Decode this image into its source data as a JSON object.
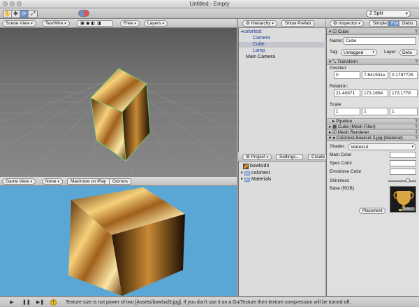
{
  "window": {
    "title": "Untitled - Empty"
  },
  "toolbar": {
    "tools": [
      {
        "name": "hand-icon",
        "glyph": "✋"
      },
      {
        "name": "move-icon",
        "glyph": "✥"
      },
      {
        "name": "rotate-icon",
        "glyph": "⟳"
      },
      {
        "name": "scale-icon",
        "glyph": "⤢"
      }
    ],
    "layout_select": "2 Split"
  },
  "scene_view": {
    "tab_label": "Scene View",
    "render_mode": "Tex/Wire",
    "camera_mode": "Free",
    "layers": "Layers"
  },
  "game_view": {
    "tab_label": "Game View",
    "aspect": "None",
    "maximize": "Maximize on Play",
    "gizmos": "Gizmos"
  },
  "hierarchy": {
    "tab_label": "Hierarchy",
    "show_prefab": "Show Prefab",
    "items": [
      {
        "label": "colortest",
        "level": 0
      },
      {
        "label": "Camera",
        "level": 1
      },
      {
        "label": "Cube",
        "level": 1
      },
      {
        "label": "Lamp",
        "level": 1
      },
      {
        "label": "Main Camera",
        "level": 0
      }
    ]
  },
  "project": {
    "tab_label": "Project",
    "settings": "Settings...",
    "create": "Create",
    "items": [
      {
        "label": "bowlsid3",
        "kind": "texture"
      },
      {
        "label": "colortest",
        "kind": "folder"
      },
      {
        "label": "Materials",
        "kind": "folder"
      }
    ]
  },
  "inspector": {
    "tab_label": "Inspector",
    "mode_simple": "Simple",
    "mode_full": "Full",
    "mode_debug": "Debu",
    "object_header": "Cube",
    "name_label": "Name:",
    "name_value": "Cube",
    "tag_label": "Tag:",
    "tag_value": "Untagged",
    "layer_label": "Layer:",
    "layer_value": "Defa",
    "transform": {
      "title": "Transform",
      "position_label": "Position:",
      "position": [
        "0",
        "7.641531e",
        "0.1787725"
      ],
      "rotation_label": "Rotation:",
      "rotation": [
        "21.40871",
        "173.1654",
        "173.1778"
      ],
      "scale_label": "Scale:",
      "scale": [
        "1",
        "1",
        "1"
      ]
    },
    "pipeline": "Pipeline",
    "mesh_filter": "Cube (Mesh Filter)",
    "mesh_renderer": "Mesh Renderer",
    "material": {
      "title": "Colortest-bowlsid 3.jpg (Material)",
      "shader_label": "Shader:",
      "shader_value": "VertexLit",
      "main_color": "Main Color",
      "spec_color": "Spec Color",
      "emissive_color": "Emmisive Color",
      "shininess": "Shininess",
      "shininess_value": 0.7,
      "base": "Base (RGB)",
      "placement": "Placement",
      "select": "Select"
    },
    "help_glyph": "?"
  },
  "status": {
    "message": "Texture size is not power of two [Assets/bowlsid3.jpg]. If you don't use it on a GuiTexture then texture compression will be turned off."
  }
}
